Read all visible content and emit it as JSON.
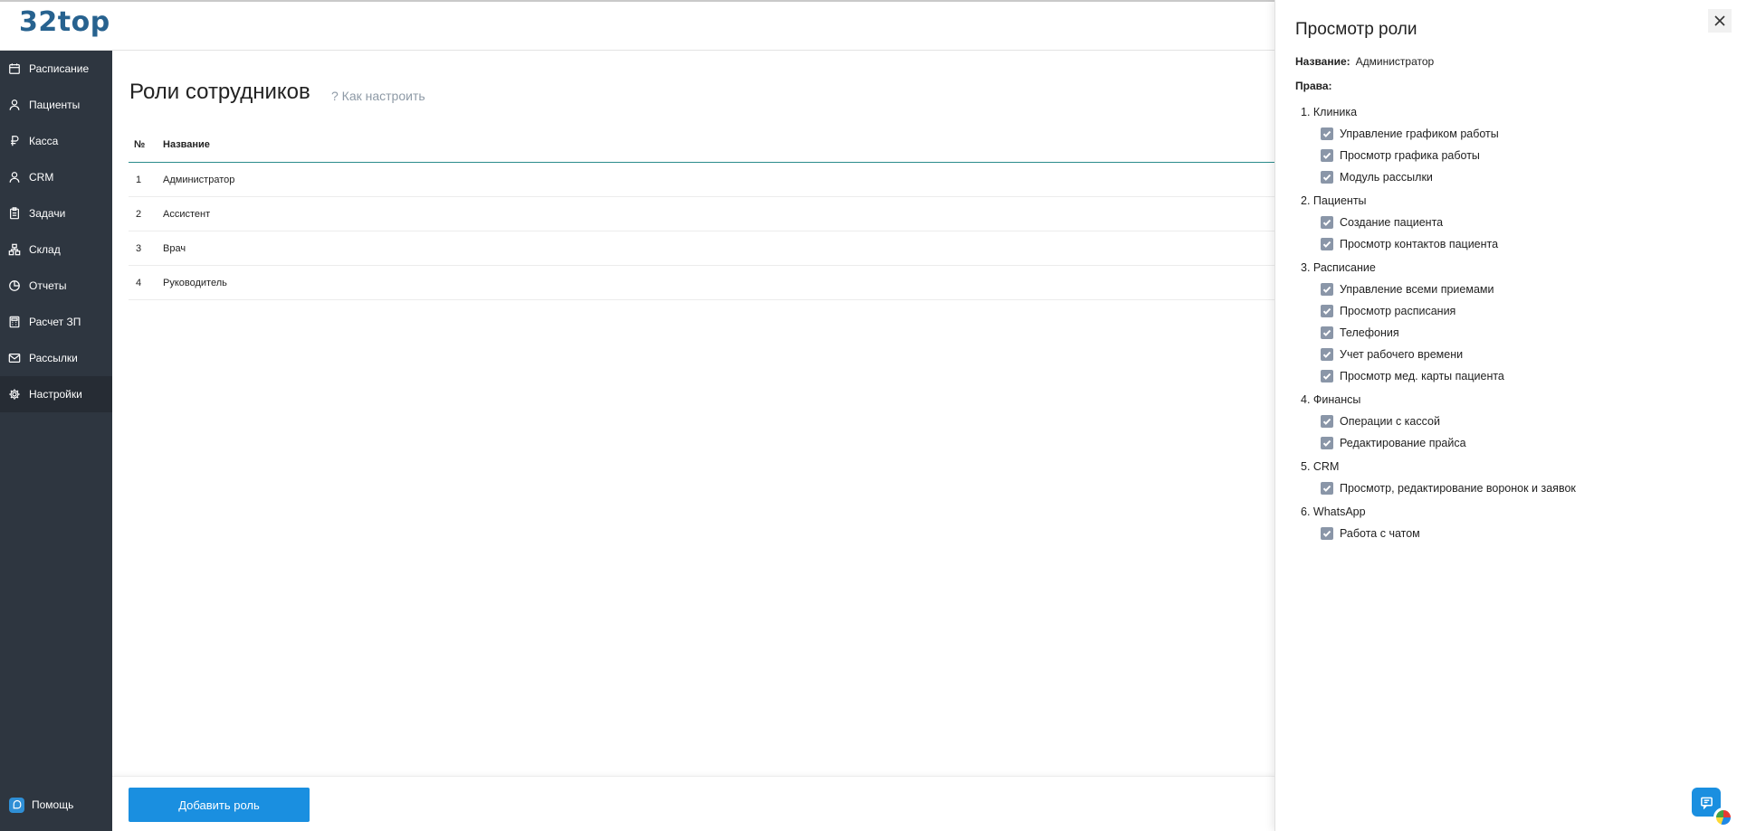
{
  "app": {
    "logo": "32top"
  },
  "sidebar": {
    "items": [
      {
        "label": "Расписание",
        "icon": "calendar-icon"
      },
      {
        "label": "Пациенты",
        "icon": "user-icon"
      },
      {
        "label": "Касса",
        "icon": "ruble-icon"
      },
      {
        "label": "CRM",
        "icon": "user-icon"
      },
      {
        "label": "Задачи",
        "icon": "clipboard-icon"
      },
      {
        "label": "Склад",
        "icon": "warehouse-icon"
      },
      {
        "label": "Отчеты",
        "icon": "pie-chart-icon"
      },
      {
        "label": "Расчет ЗП",
        "icon": "calculator-icon"
      },
      {
        "label": "Рассылки",
        "icon": "mail-icon"
      },
      {
        "label": "Настройки",
        "icon": "gear-icon",
        "active": true
      }
    ],
    "help": {
      "label": "Помощь",
      "icon": "help-icon"
    }
  },
  "main": {
    "title": "Роли сотрудников",
    "howto": "? Как настроить",
    "table": {
      "columns": [
        "№",
        "Название"
      ],
      "rows": [
        {
          "num": "1",
          "name": "Администратор"
        },
        {
          "num": "2",
          "name": "Ассистент"
        },
        {
          "num": "3",
          "name": "Врач"
        },
        {
          "num": "4",
          "name": "Руководитель"
        }
      ]
    },
    "add_button": "Добавить роль"
  },
  "panel": {
    "title": "Просмотр роли",
    "name_label": "Название:",
    "name_value": "Администратор",
    "rights_label": "Права:",
    "groups": [
      {
        "title": "1. Клиника",
        "perms": [
          "Управление графиком работы",
          "Просмотр графика работы",
          "Модуль рассылки"
        ]
      },
      {
        "title": "2. Пациенты",
        "perms": [
          "Создание пациента",
          "Просмотр контактов пациента"
        ]
      },
      {
        "title": "3. Расписание",
        "perms": [
          "Управление всеми приемами",
          "Просмотр расписания",
          "Телефония",
          "Учет рабочего времени",
          "Просмотр мед. карты пациента"
        ]
      },
      {
        "title": "4. Финансы",
        "perms": [
          "Операции с кассой",
          "Редактирование прайса"
        ]
      },
      {
        "title": "5. CRM",
        "perms": [
          "Просмотр, редактирование воронок и заявок"
        ]
      },
      {
        "title": "6. WhatsApp",
        "perms": [
          "Работа с чатом"
        ]
      }
    ]
  },
  "colors": {
    "sidebar": "#2e3640",
    "accent": "#1a8fe0",
    "logo": "#27628f",
    "checkbox": "#8a96a8"
  }
}
